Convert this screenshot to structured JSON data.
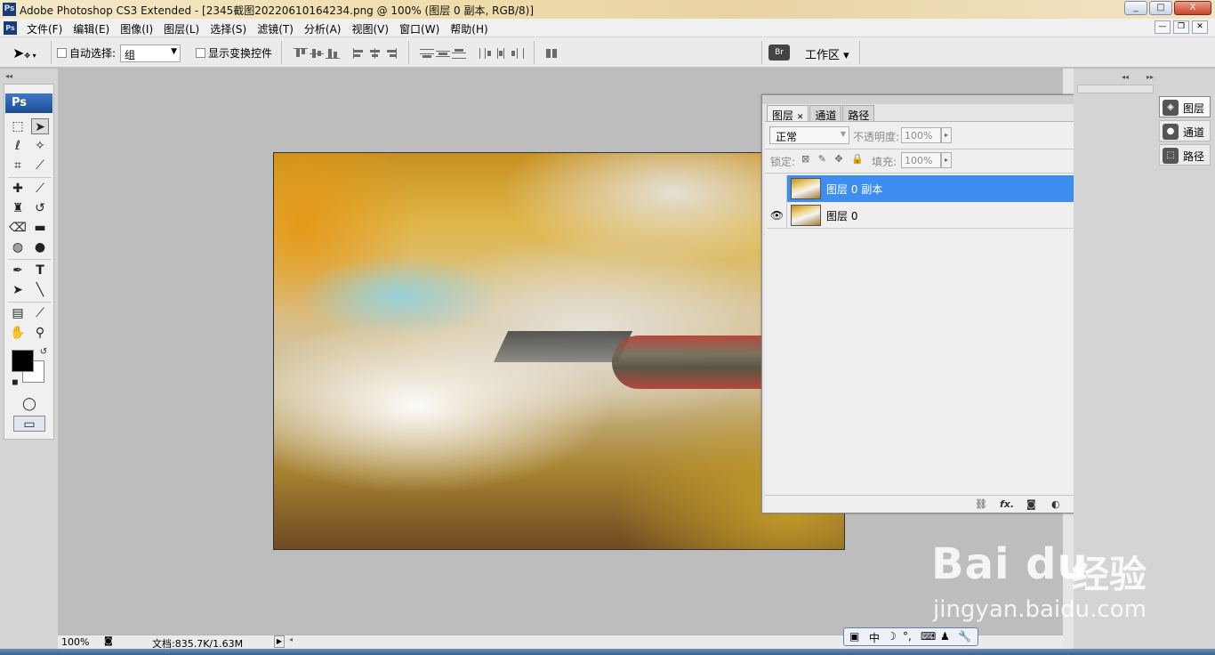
{
  "window": {
    "logo": "Ps",
    "title": "Adobe Photoshop CS3 Extended - [2345截图20220610164234.png @ 100% (图层 0 副本, RGB/8)]",
    "controls": [
      "_",
      "□",
      "X"
    ]
  },
  "menu": {
    "items": [
      "文件(F)",
      "编辑(E)",
      "图像(I)",
      "图层(L)",
      "选择(S)",
      "滤镜(T)",
      "分析(A)",
      "视图(V)",
      "窗口(W)",
      "帮助(H)"
    ],
    "doc_controls": [
      "—",
      "❐",
      "✕"
    ]
  },
  "options": {
    "auto_select_label": "自动选择:",
    "auto_select_value": "组",
    "show_transform_label": "显示变换控件",
    "workspace_label": "工作区 ▾"
  },
  "tools": {
    "logo": "Ps",
    "icons": [
      "marquee-icon",
      "move-icon",
      "lasso-icon",
      "magic-wand-icon",
      "crop-icon",
      "slice-icon",
      "healing-icon",
      "brush-icon",
      "stamp-icon",
      "history-brush-icon",
      "eraser-icon",
      "gradient-icon",
      "blur-icon",
      "dodge-icon",
      "pen-icon",
      "type-icon",
      "path-select-icon",
      "line-icon",
      "notes-icon",
      "eyedropper-icon",
      "hand-icon",
      "zoom-icon"
    ],
    "type_glyph": "T",
    "foreground_color": "#000000",
    "background_color": "#ffffff"
  },
  "layers_panel": {
    "tabs": [
      "图层",
      "通道",
      "路径"
    ],
    "blend_mode": "正常",
    "opacity_label": "不透明度:",
    "opacity_value": "100%",
    "lock_label": "锁定:",
    "fill_label": "填充:",
    "fill_value": "100%",
    "layers": [
      {
        "name": "图层 0 副本",
        "visible": false,
        "selected": true
      },
      {
        "name": "图层 0",
        "visible": true,
        "selected": false
      }
    ],
    "footer_icons": [
      "link-icon",
      "fx-icon",
      "mask-icon",
      "adjustment-icon",
      "group-icon",
      "new-layer-icon",
      "trash-icon"
    ],
    "fx_label": "fx."
  },
  "dock": {
    "items": [
      "图层",
      "通道",
      "路径"
    ]
  },
  "status": {
    "zoom": "100%",
    "doc_info": "文档:835.7K/1.63M"
  },
  "ime": {
    "items": [
      "中",
      "☽",
      "°,",
      "⌨",
      "♟",
      "🔧"
    ]
  },
  "watermark": {
    "brand": "Bai du",
    "product": "经验",
    "url": "jingyan.baidu.com"
  },
  "colors": {
    "selection_blue": "#3d8ef0",
    "canvas_bg": "#bdbdbd"
  }
}
